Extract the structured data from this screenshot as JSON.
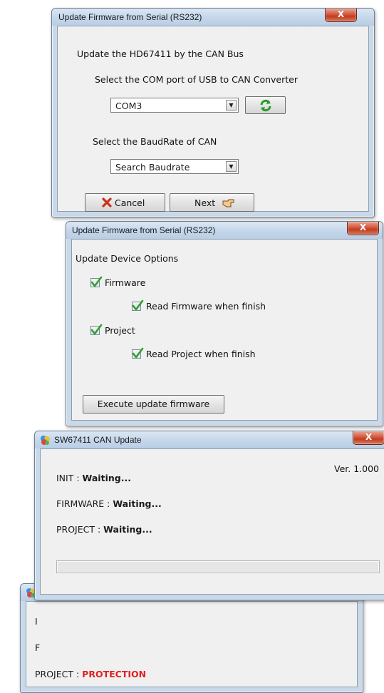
{
  "window1": {
    "title": "Update Firmware from Serial (RS232)",
    "close_label": "X",
    "heading": "Update the HD67411 by the CAN Bus",
    "com_prompt": "Select the COM port of USB to CAN Converter",
    "com_value": "COM3",
    "baud_prompt": "Select the BaudRate of CAN",
    "baud_value": "Search Baudrate",
    "cancel_label": "Cancel",
    "next_label": "Next"
  },
  "window2": {
    "title": "Update Firmware from Serial (RS232)",
    "close_label": "X",
    "heading": "Update Device Options",
    "options": [
      {
        "label": "Firmware",
        "checked": true
      },
      {
        "label": "Read Firmware when finish",
        "checked": true
      },
      {
        "label": "Project",
        "checked": true
      },
      {
        "label": "Read Project when finish",
        "checked": true
      }
    ],
    "execute_label": "Execute update firmware"
  },
  "window3": {
    "title": "SW67411 CAN Update",
    "close_label": "X",
    "version": "Ver. 1.000",
    "rows": [
      {
        "label": "INIT : ",
        "status": "Waiting..."
      },
      {
        "label": "FIRMWARE : ",
        "status": "Waiting..."
      },
      {
        "label": "PROJECT : ",
        "status": "Waiting..."
      }
    ],
    "progress": 0
  },
  "window4": {
    "partial_1": "I",
    "partial_2": "F",
    "project_label": "PROJECT : ",
    "project_status": "PROTECTION",
    "progress": 0
  },
  "colors": {
    "error_red": "#e02020",
    "close_red": "#c9452a",
    "check_green": "#2fa02f"
  },
  "icons": [
    "refresh-icon",
    "cancel-x-icon",
    "hand-pointer-icon",
    "app-icon",
    "checkmark-icon"
  ]
}
